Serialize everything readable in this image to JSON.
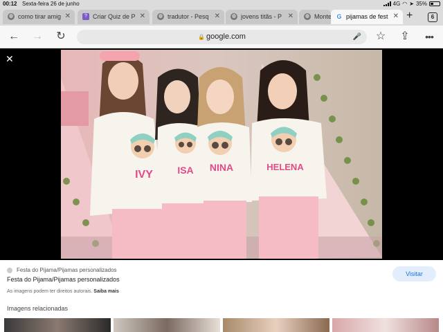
{
  "status_bar": {
    "time": "00:12",
    "date": "Sexta-feira 26 de junho",
    "network": "4G",
    "battery": "35%",
    "battery_level": 0.35
  },
  "tabs": [
    {
      "title": "como tirar amig",
      "icon": "globe-icon"
    },
    {
      "title": "Criar Quiz de P",
      "icon": "quiz-icon"
    },
    {
      "title": "tradutor - Pesq",
      "icon": "globe-icon"
    },
    {
      "title": "jovens titãs - P",
      "icon": "globe-icon"
    },
    {
      "title": "Monte",
      "icon": "globe-icon"
    },
    {
      "title": "pijamas de fest",
      "icon": "google-icon",
      "active": true
    }
  ],
  "tab_count": "6",
  "omnibox": {
    "url": "google.com"
  },
  "photo": {
    "shirt_names": [
      "IVY",
      "ISA",
      "NINA",
      "HELENA"
    ]
  },
  "info": {
    "source": "Festa do Pijama/Pijamas personalizados",
    "title": "Festa do Pijama/Pijamas personalizados",
    "copyright": "As imagens podem ter direitos autorais.",
    "learn_more": "Saiba mais",
    "visit_label": "Visitar",
    "related_title": "Imagens relacionadas"
  },
  "colors": {
    "accent": "#1a73e8",
    "visit_bg": "#e3eefc",
    "shirt_letters": "#e04a86"
  }
}
